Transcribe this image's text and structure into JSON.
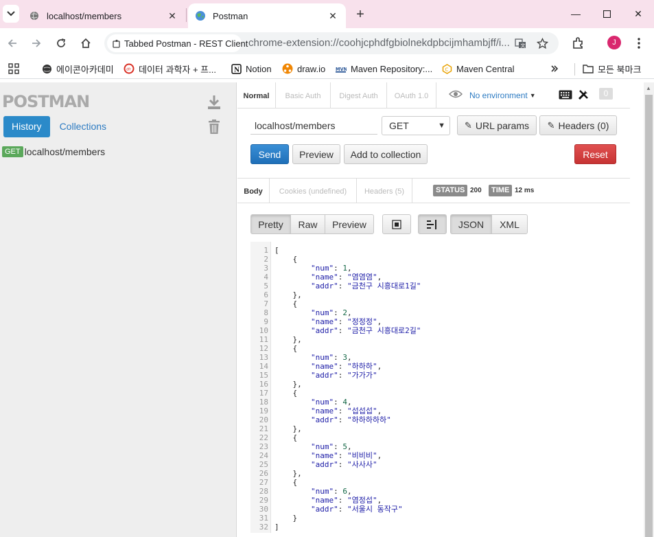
{
  "browser": {
    "tabs": [
      {
        "title": "localhost/members",
        "icon": "globe-icon"
      },
      {
        "title": "Postman",
        "icon": "postman-globe-icon"
      }
    ],
    "site_chip": "Tabbed Postman - REST Client",
    "url": "chrome-extension://coohjcphdfgbiolnekdpbcijmhambjff/i...",
    "profile_initial": "J",
    "bookmarks": [
      {
        "label": "에이콘아카데미",
        "icon": "globe-icon"
      },
      {
        "label": "데이터 과학자 + 프...",
        "icon": "red-ring-icon"
      },
      {
        "label": "Notion",
        "icon": "notion-icon"
      },
      {
        "label": "draw.io",
        "icon": "drawio-icon"
      },
      {
        "label": "Maven Repository:...",
        "icon": "mvn-icon"
      },
      {
        "label": "Maven Central",
        "icon": "maven-central-icon"
      }
    ],
    "all_bookmarks": "모든 북마크"
  },
  "sidebar": {
    "logo": "POSTMAN",
    "tab_history": "History",
    "tab_collections": "Collections",
    "history": [
      {
        "method": "GET",
        "url": "localhost/members"
      }
    ]
  },
  "request": {
    "auth_tabs": [
      "Normal",
      "Basic Auth",
      "Digest Auth",
      "OAuth 1.0"
    ],
    "environment": "No environment",
    "badge_count": "0",
    "url": "localhost/members",
    "method": "GET",
    "url_params_label": "URL params",
    "headers_label": "Headers (0)",
    "send_label": "Send",
    "preview_label": "Preview",
    "add_collection_label": "Add to collection",
    "reset_label": "Reset"
  },
  "response": {
    "tabs": [
      "Body",
      "Cookies (undefined)",
      "Headers (5)"
    ],
    "status_label": "STATUS",
    "status_value": "200",
    "time_label": "TIME",
    "time_value": "12 ms",
    "view_buttons": [
      "Pretty",
      "Raw",
      "Preview"
    ],
    "format_buttons": [
      "JSON",
      "XML"
    ],
    "members": [
      {
        "num": 1,
        "name": "염염염",
        "addr": "금천구 시흥대로1길"
      },
      {
        "num": 2,
        "name": "정정정",
        "addr": "금천구 시흥대로2길"
      },
      {
        "num": 3,
        "name": "하하하",
        "addr": "가가가"
      },
      {
        "num": 4,
        "name": "섭섭섭",
        "addr": "하하하하하"
      },
      {
        "num": 5,
        "name": "비비비",
        "addr": "사사사"
      },
      {
        "num": 6,
        "name": "염정섭",
        "addr": "서울시 동작구"
      }
    ]
  }
}
